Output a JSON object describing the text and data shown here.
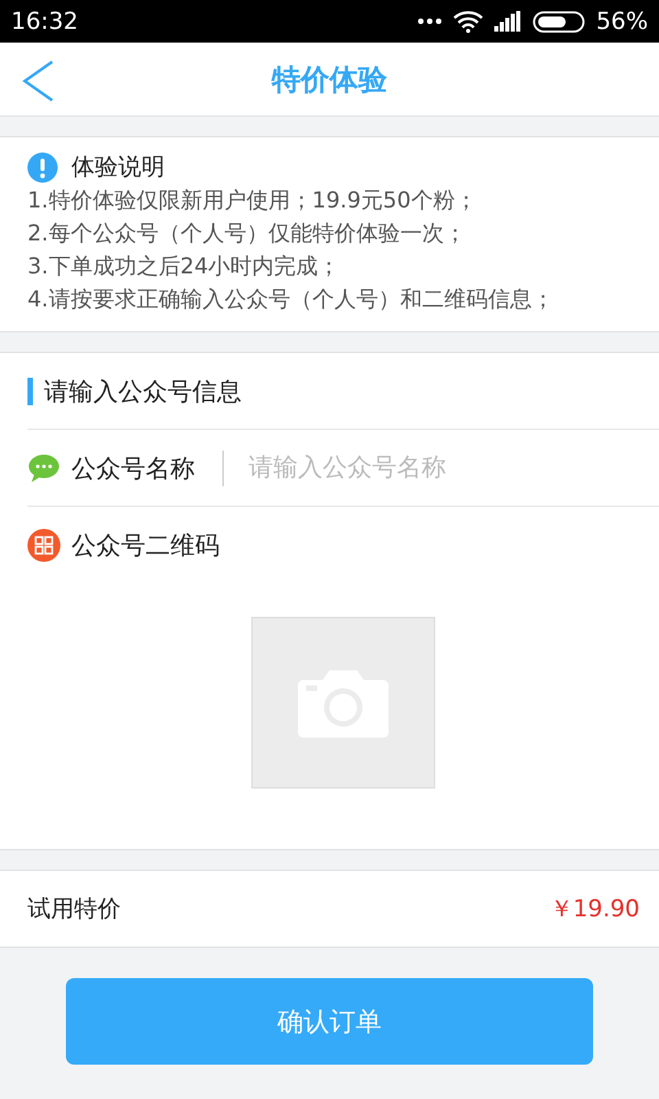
{
  "status_bar": {
    "time": "16:32",
    "battery": "56%"
  },
  "header": {
    "title": "特价体验"
  },
  "notice": {
    "title": "体验说明",
    "lines": [
      "1.特价体验仅限新用户使用；19.9元50个粉；",
      "2.每个公众号（个人号）仅能特价体验一次；",
      "3.下单成功之后24小时内完成；",
      "4.请按要求正确输入公众号（个人号）和二维码信息；"
    ]
  },
  "form": {
    "heading": "请输入公众号信息",
    "name_field": {
      "label": "公众号名称",
      "placeholder": "请输入公众号名称"
    },
    "qr_field": {
      "label": "公众号二维码"
    }
  },
  "price": {
    "label": "试用特价",
    "value": "￥19.90"
  },
  "submit": {
    "label": "确认订单"
  }
}
